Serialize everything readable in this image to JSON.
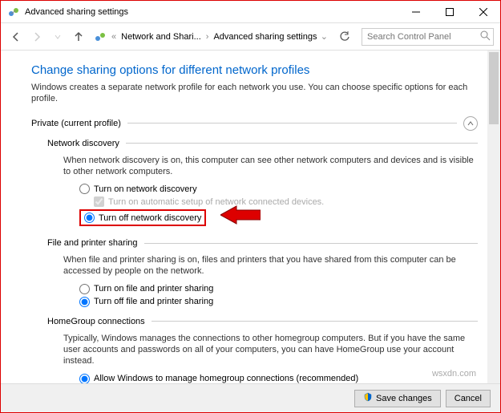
{
  "window": {
    "title": "Advanced sharing settings"
  },
  "breadcrumb": {
    "item1": "Network and Shari...",
    "item2": "Advanced sharing settings"
  },
  "search": {
    "placeholder": "Search Control Panel"
  },
  "page": {
    "heading": "Change sharing options for different network profiles",
    "description": "Windows creates a separate network profile for each network you use. You can choose specific options for each profile."
  },
  "profile": {
    "label": "Private (current profile)"
  },
  "sections": {
    "network_discovery": {
      "title": "Network discovery",
      "description": "When network discovery is on, this computer can see other network computers and devices and is visible to other network computers.",
      "option_on": "Turn on network discovery",
      "option_auto": "Turn on automatic setup of network connected devices.",
      "option_off": "Turn off network discovery"
    },
    "file_printer": {
      "title": "File and printer sharing",
      "description": "When file and printer sharing is on, files and printers that you have shared from this computer can be accessed by people on the network.",
      "option_on": "Turn on file and printer sharing",
      "option_off": "Turn off file and printer sharing"
    },
    "homegroup": {
      "title": "HomeGroup connections",
      "description": "Typically, Windows manages the connections to other homegroup computers. But if you have the same user accounts and passwords on all of your computers, you can have HomeGroup use your account instead.",
      "option_allow": "Allow Windows to manage homegroup connections (recommended)"
    }
  },
  "buttons": {
    "save": "Save changes",
    "cancel": "Cancel"
  },
  "watermark": "wsxdn.com"
}
